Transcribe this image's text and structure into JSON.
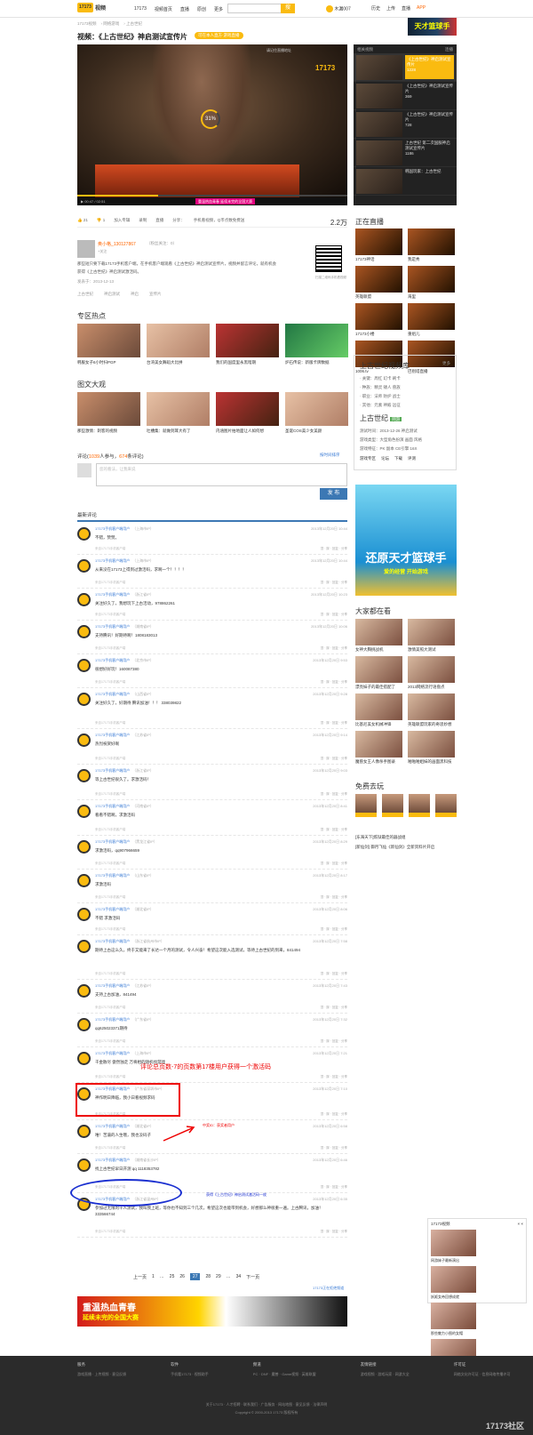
{
  "header": {
    "logo": "17173",
    "logo_sub": "视频",
    "nav": [
      "17173",
      "视频首页",
      "直播",
      "原创",
      "更多"
    ],
    "search_button": "搜",
    "user": "木漏007",
    "links": [
      "历史",
      "上传",
      "直播",
      "APP"
    ],
    "ad": "天才篮球手"
  },
  "breadcrumb": [
    "17173视频",
    "网络游戏",
    "上古世纪"
  ],
  "video": {
    "title": "视频：《上古世纪》神启测试宣传片",
    "tag": "可在本人直方·游戏直播",
    "loading": "31%",
    "player_logo": "17173",
    "player_note": "请记住直播地址",
    "time": "00:47 / 02:51",
    "ad": "重温热血青春 延续未完的全国大赛"
  },
  "related": {
    "title": "相关视频",
    "toggle": "连播",
    "items": [
      {
        "title": "《上古世纪》神启测试宣传片",
        "meta": "1228"
      },
      {
        "title": "《上古世纪》神启测试宣传片",
        "meta": "369"
      },
      {
        "title": "《上古世纪》神启测试宣传片",
        "meta": "728"
      },
      {
        "title": "上古世纪 第二次国服神启测试宣传片",
        "meta": "1186"
      },
      {
        "title": "韩国玩家：上古世纪"
      }
    ]
  },
  "actions": {
    "up": "21",
    "down": "1",
    "fav": "加入专辑",
    "embed": "录制",
    "live": "直播",
    "share": "分享：",
    "mobile": "手机看视频，Q币点数免费送",
    "plays": "2.2万"
  },
  "uploader": {
    "name": "奥小格_130127867",
    "fans": "（粉丝关注：0）",
    "follow": "+关注",
    "desc": "那些短只要下载17173手机客户端，在手机客户端观看《上古世纪》神启测试宣传片，视频并留言评论，就有机会获得《上古世纪》神启测试激活码。",
    "date": "发表于：2013-12-13",
    "tags": [
      "上古世纪",
      "神启测试",
      "神启",
      "宣传片"
    ],
    "qr_note": "扫描二维码手机看视频"
  },
  "zone": {
    "title": "专区热点",
    "items": [
      "韩服女子6小时扫PGP",
      "台湾美女舞蹈大比拼",
      "我们的国度里永黑暗期",
      "炉石传说：新版卡牌数据"
    ]
  },
  "gallery": {
    "title": "图文大观",
    "items": [
      "那些激情：刺客的视频",
      "吐槽集：就做到耳大有了",
      "内涵图片拍地面让人如何想",
      "圣诞COS美少女美颜"
    ]
  },
  "comment_box": {
    "label_a": "评论(",
    "count": "1039",
    "label_b": "人参与，",
    "count2": "674",
    "label_c": "条评论)",
    "right": "按时间排序",
    "placeholder": "您的看法，让我来说",
    "post": "发 布"
  },
  "latest": "最新评论",
  "comments": [
    {
      "user": "17173手机客户端用户",
      "tag": "（上海市IP）",
      "time": "2013年12月20日 10:44",
      "text": "不错，赞赞。"
    },
    {
      "user": "17173手机客户端用户",
      "tag": "（上海市IP）",
      "time": "2013年12月20日 10:44",
      "text": "从来没在17173上得到过激活码，求啊一个！！！！"
    },
    {
      "user": "17173手机客户端用户",
      "tag": "（浙江省IP）",
      "time": "2013年12月20日 10:23",
      "text": "关注好久了，我想玩下上古活动，978862261"
    },
    {
      "user": "17173手机客户端用户",
      "tag": "（湖南省IP）",
      "time": "2013年12月20日 10:06",
      "text": "支持腾讯！好期待啊！1808183013"
    },
    {
      "user": "17173手机客户端用户",
      "tag": "（北京市IP）",
      "time": "2013年12月20日 9:53",
      "text": "很想好好玩！160087380"
    },
    {
      "user": "17173手机客户端用户",
      "tag": "（山西省IP）",
      "time": "2013年12月20日 9:28",
      "text": "关注好久了，好期待 腾讯加油！！！ 338039822"
    },
    {
      "user": "17173手机客户端用户",
      "tag": "（江苏省IP）",
      "time": "2013年12月20日 9:14",
      "text": "热烈祝贺好啊"
    },
    {
      "user": "17173手机客户端用户",
      "tag": "（浙江省IP）",
      "time": "2013年12月20日 9:03",
      "text": "等上古世纪很久了。求激活码！"
    },
    {
      "user": "17173手机客户端用户",
      "tag": "（河南省IP）",
      "time": "2013年12月20日 8:41",
      "text": "看看不错啊，求激活码"
    },
    {
      "user": "17173手机客户端用户",
      "tag": "（黑龙江省IP）",
      "time": "2013年12月20日 8:29",
      "text": "求激活码，qq907966659"
    },
    {
      "user": "17173手机客户端用户",
      "tag": "（山东省IP）",
      "time": "2013年12月20日 8:17",
      "text": "求激活码"
    },
    {
      "user": "17173手机客户端用户",
      "tag": "（湖北省IP）",
      "time": "2013年12月20日 8:06",
      "text": "不错 求激活码"
    },
    {
      "user": "17173手机客户端用户",
      "tag": "（浙江省杭州市IP）",
      "time": "2013年12月20日 7:58",
      "text": "期待上古这么久，终于又能来了长达一个月的测试，令人兴奋！希望这次能入选测试，等待上古世纪的到来，841494"
    },
    {
      "user": "17173手机客户端用户",
      "tag": "（江苏省IP）",
      "time": "2013年12月20日 7:43",
      "text": "支持上古加油，841494"
    },
    {
      "user": "17173手机客户端用户",
      "tag": "（广东省IP）",
      "time": "2013年12月20日 7:32",
      "text": "qq625023371期待"
    },
    {
      "user": "17173手机客户端用户",
      "tag": "（上海市IP）",
      "time": "2013年12月20日 7:21",
      "text": "千金散尽 傲然独走 万将相的随机找游戏"
    },
    {
      "user": "17173手机客户端用户",
      "tag": "（广东省深圳市IP）",
      "time": "2013年12月20日 7:10",
      "text": "神作明日降临，我小日看视频求码"
    },
    {
      "user": "17173手机客户端用户",
      "tag": "（湖北省IP）",
      "time": "2013年12月20日 6:58",
      "text": "唯！苦逼的人生哦，我也没码子"
    },
    {
      "user": "17173手机客户端用户",
      "tag": "（湖南省长沙IP）",
      "time": "2013年12月20日 6:46",
      "text": "找上古世纪早日开测 qq 1118353782"
    },
    {
      "user": "17173手机客户端用户",
      "tag": "（浙江省温州IP）",
      "time": "2013年12月20日 6:35",
      "text": "参加过无限的千人测试，我叫我上班，等你也不知到三个几次，希望这次也能带到机会，好想那么神很重一遍。上古腾讯，加油！ 333566744"
    }
  ],
  "comment_footer": "来自17173手机客户端",
  "comment_ops": [
    "顶",
    "踩",
    "回复",
    "分享"
  ],
  "annotations": {
    "red": "评论总页数-7的页数第17楼用户获得一个激活码",
    "red_small": "中奖ID：获奖者用户",
    "blue": "获得《上古世纪》神启测试激活码一枚"
  },
  "pager": {
    "prev": "上一页",
    "next": "下一页",
    "pages": [
      "1",
      "…",
      "25",
      "26",
      "27",
      "28",
      "29",
      "…",
      "34"
    ],
    "current": "27",
    "right": "17173正在拒绝频道"
  },
  "bottom_ad": {
    "line1": "重温热血青春",
    "line2": "延续未完的全国大赛"
  },
  "live": {
    "title": "正在直播",
    "items": [
      {
        "title": "17173神话",
        "tag": "我是秀"
      },
      {
        "title": "英雄联盟",
        "tag": "海里"
      },
      {
        "title": "17173小楼",
        "tag": "重组儿"
      },
      {
        "title": "1006.tv",
        "tag": "巴别塔直播"
      }
    ]
  },
  "game_box": {
    "title": "上古世纪视频库",
    "more": "更多",
    "rows": [
      "· 关键：周红 幻卡 刷卡",
      "· 种族：精灵 矮人 兽族",
      "· 职业：法师 防护 战士",
      "· 其他：元素 神殿 远征"
    ],
    "game": "上古世纪",
    "game_tag": "网游",
    "info": [
      "测试时间：2013-12-26 神启测试",
      "游戏类型：大型角色扮演 画面 风格",
      "游戏特征：PK 副本 CE引擎 16X"
    ],
    "btns": [
      "游戏专区",
      "论坛",
      "下载",
      "评测"
    ]
  },
  "game_ad": {
    "line1": "还原天才篮球手",
    "line2": "爱的经营 开始游戏"
  },
  "everyone": {
    "title": "大家都在看",
    "items": [
      "女神大胸挑战机",
      "激情美照大测试",
      "漂亮妹子的最佳搭配了",
      "2013网络流行语盘点",
      "比基尼美女机械冲锋",
      "英雄联盟玩家的奇思妙想",
      "魔兽女王人像杀手图录",
      "啪啪啪姐妹的画面黑科技"
    ]
  },
  "free": {
    "title": "免费去玩",
    "links": [
      "[东海天下]炼狱最佳的器战组",
      "[新仙剑] 御月飞仙《新仙剑》全新资料片开启"
    ]
  },
  "float": {
    "title": "17173视频",
    "close": "× ×",
    "items": [
      "网游妹子最新演出",
      "妖姬女帝回想成就",
      "那些魅力小图的女帽",
      "驱火边游戏视频教程"
    ]
  },
  "footer": {
    "cols": [
      {
        "h": "服务",
        "p": "游戏直播 · 上传视频 · 意见反馈"
      },
      {
        "h": "软件",
        "p": "手机看17173 · 视频助手"
      },
      {
        "h": "频道",
        "p": "PC · DNF · 魔兽 · Game视频 · 英雄联盟"
      },
      {
        "h": "友情链接",
        "p": "游戏视频 · 游戏玩家 · 网游大全"
      },
      {
        "h": "许可证",
        "p": "网络文化许可证 · 信息网络传播许可"
      }
    ],
    "copy1": "关于17173 · 人才招聘 · 联系我们 · 广告服务 · 网站地图 · 意见反馈 · 法律声明",
    "copy2": "Copyright © 2000-2013 17173 版权所有",
    "mark": "17173社区"
  }
}
